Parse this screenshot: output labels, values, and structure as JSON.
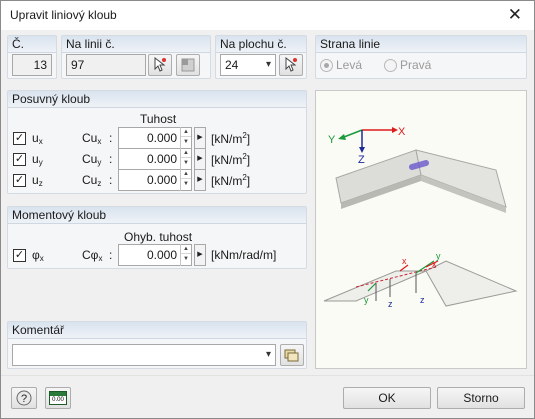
{
  "window": {
    "title": "Upravit liniový kloub"
  },
  "top": {
    "no_label": "Č.",
    "no_value": "13",
    "line_label": "Na linii č.",
    "line_value": "97",
    "surface_label": "Na plochu č.",
    "surface_value": "24",
    "side_label": "Strana linie",
    "side_left": "Levá",
    "side_right": "Pravá",
    "side_selected": "Levá"
  },
  "translational": {
    "title": "Posuvný kloub",
    "column_header": "Tuhost",
    "rows": [
      {
        "check": true,
        "dof": "u",
        "dof_sub": "x",
        "const": "Cu",
        "const_sub": "x",
        "value": "0.000",
        "unit": "[kN/m",
        "unit_sup": "2",
        "unit_end": "]"
      },
      {
        "check": true,
        "dof": "u",
        "dof_sub": "y",
        "const": "Cu",
        "const_sub": "y",
        "value": "0.000",
        "unit": "[kN/m",
        "unit_sup": "2",
        "unit_end": "]"
      },
      {
        "check": true,
        "dof": "u",
        "dof_sub": "z",
        "const": "Cu",
        "const_sub": "z",
        "value": "0.000",
        "unit": "[kN/m",
        "unit_sup": "2",
        "unit_end": "]"
      }
    ]
  },
  "rotational": {
    "title": "Momentový kloub",
    "column_header": "Ohyb. tuhost",
    "row": {
      "check": true,
      "dof": "φ",
      "dof_sub": "x",
      "const": "Cφ",
      "const_sub": "x",
      "value": "0.000",
      "unit": "[kNm/rad/m]"
    }
  },
  "comment": {
    "title": "Komentář",
    "value": ""
  },
  "preview": {
    "axis_labels": [
      "X",
      "Y",
      "Z"
    ],
    "bottom_labels": [
      "x",
      "y",
      "z",
      "x",
      "y",
      "z"
    ]
  },
  "footer": {
    "ok_label": "OK",
    "cancel_label": "Storno",
    "units_value": "0.00"
  },
  "colors": {
    "accent": "#d9e3ee",
    "axis_x": "#e01b1b",
    "axis_y": "#1a9a3a",
    "axis_z": "#1e2a9a",
    "hinge": "#6a5acd"
  }
}
